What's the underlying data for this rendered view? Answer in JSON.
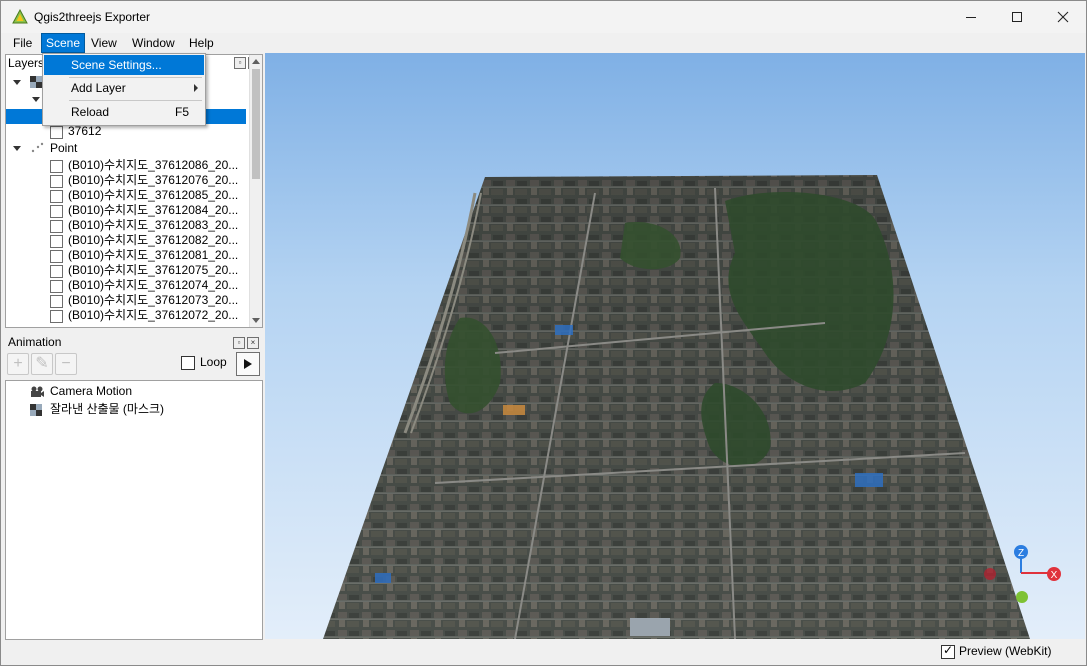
{
  "app": {
    "title": "Qgis2threejs Exporter"
  },
  "menubar": {
    "items": [
      "File",
      "Scene",
      "View",
      "Window",
      "Help"
    ]
  },
  "scene_menu": {
    "items": [
      {
        "label": "Scene Settings...",
        "shortcut": ""
      },
      {
        "label": "Add Layer",
        "shortcut": ""
      },
      {
        "label": "Reload",
        "shortcut": "F5"
      }
    ]
  },
  "layers_panel": {
    "title": "Layers",
    "items": [
      {
        "label": "37612",
        "checked": false
      },
      {
        "label": "Point",
        "checked": false
      },
      {
        "label": "(B010)수치지도_37612086_20...",
        "checked": false
      },
      {
        "label": "(B010)수치지도_37612076_20...",
        "checked": false
      },
      {
        "label": "(B010)수치지도_37612085_20...",
        "checked": false
      },
      {
        "label": "(B010)수치지도_37612084_20...",
        "checked": false
      },
      {
        "label": "(B010)수치지도_37612083_20...",
        "checked": false
      },
      {
        "label": "(B010)수치지도_37612082_20...",
        "checked": false
      },
      {
        "label": "(B010)수치지도_37612081_20...",
        "checked": false
      },
      {
        "label": "(B010)수치지도_37612075_20...",
        "checked": false
      },
      {
        "label": "(B010)수치지도_37612074_20...",
        "checked": false
      },
      {
        "label": "(B010)수치지도_37612073_20...",
        "checked": false
      },
      {
        "label": "(B010)수치지도_37612072_20...",
        "checked": false
      }
    ]
  },
  "animation_panel": {
    "title": "Animation",
    "loop_label": "Loop",
    "loop_checked": false,
    "items": [
      {
        "label": "Camera Motion",
        "icon": "camera-icon"
      },
      {
        "label": "잘라낸 산출물 (마스크)",
        "icon": "raster-layer-icon"
      }
    ]
  },
  "viewer": {
    "axes": {
      "z": "Z",
      "x": "X"
    },
    "colors": {
      "sky_top": "#7fb0e5",
      "sky_bottom": "#e3eefa",
      "x_axis": "#e0323c",
      "z_axis": "#2b7de0",
      "y_axis": "#7ec234"
    }
  },
  "statusbar": {
    "preview_label": "Preview (WebKit)",
    "preview_checked": true
  }
}
